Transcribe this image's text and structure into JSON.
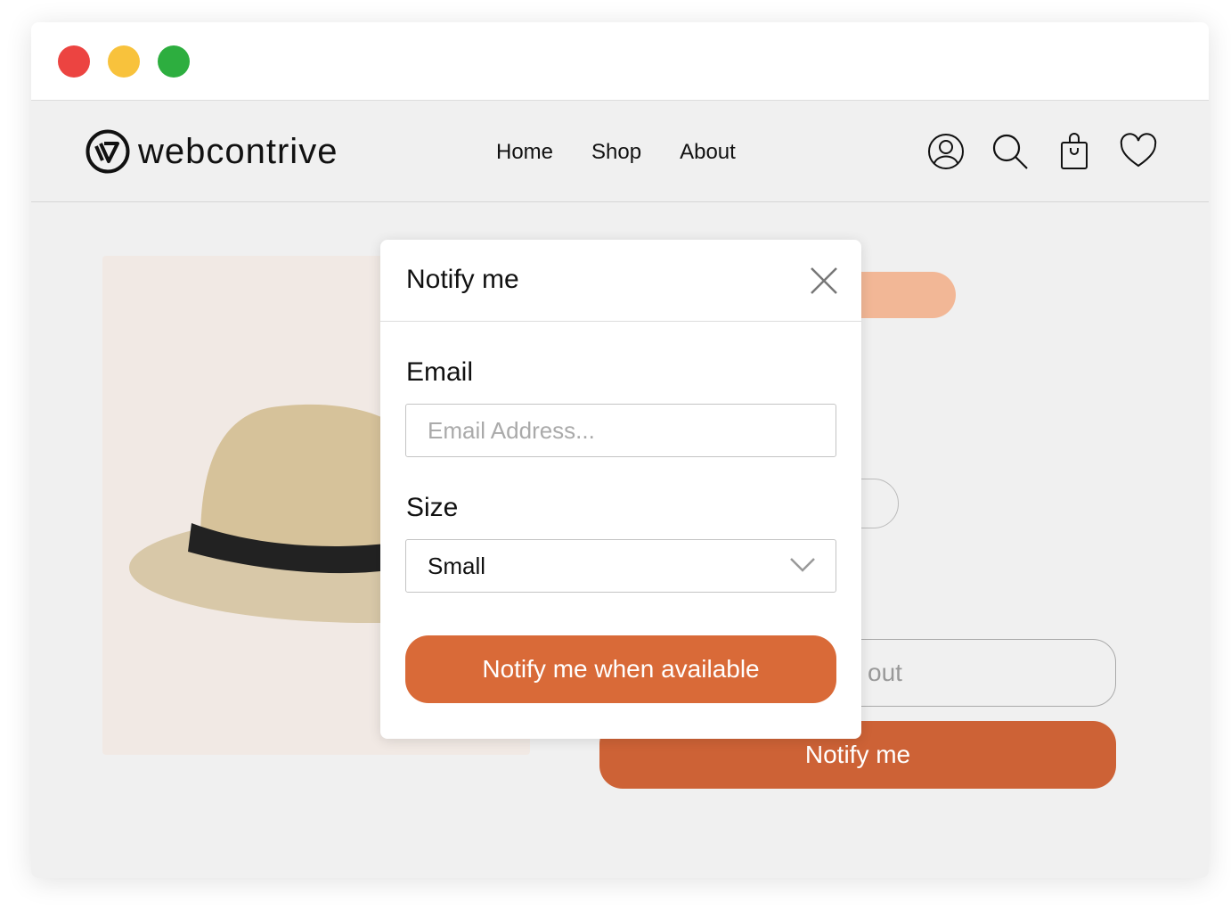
{
  "window": {
    "controls": [
      {
        "name": "close",
        "color": "#ec4441"
      },
      {
        "name": "minimize",
        "color": "#f8c23c"
      },
      {
        "name": "maximize",
        "color": "#2dae3f"
      }
    ]
  },
  "header": {
    "logo": "webcontrive",
    "nav": [
      "Home",
      "Shop",
      "About"
    ],
    "icons": [
      "user-icon",
      "search-icon",
      "shopping-bag-icon",
      "heart-icon"
    ]
  },
  "page": {
    "partial_button_label": "out",
    "notify_button_label": "Notify me",
    "accent": "#cd6236",
    "pill_color": "#f2b796"
  },
  "modal": {
    "title": "Notify me",
    "email_label": "Email",
    "email_placeholder": "Email Address...",
    "email_value": "",
    "size_label": "Size",
    "size_value": "Small",
    "submit_label": "Notify me when available",
    "accent": "#d96a38"
  }
}
